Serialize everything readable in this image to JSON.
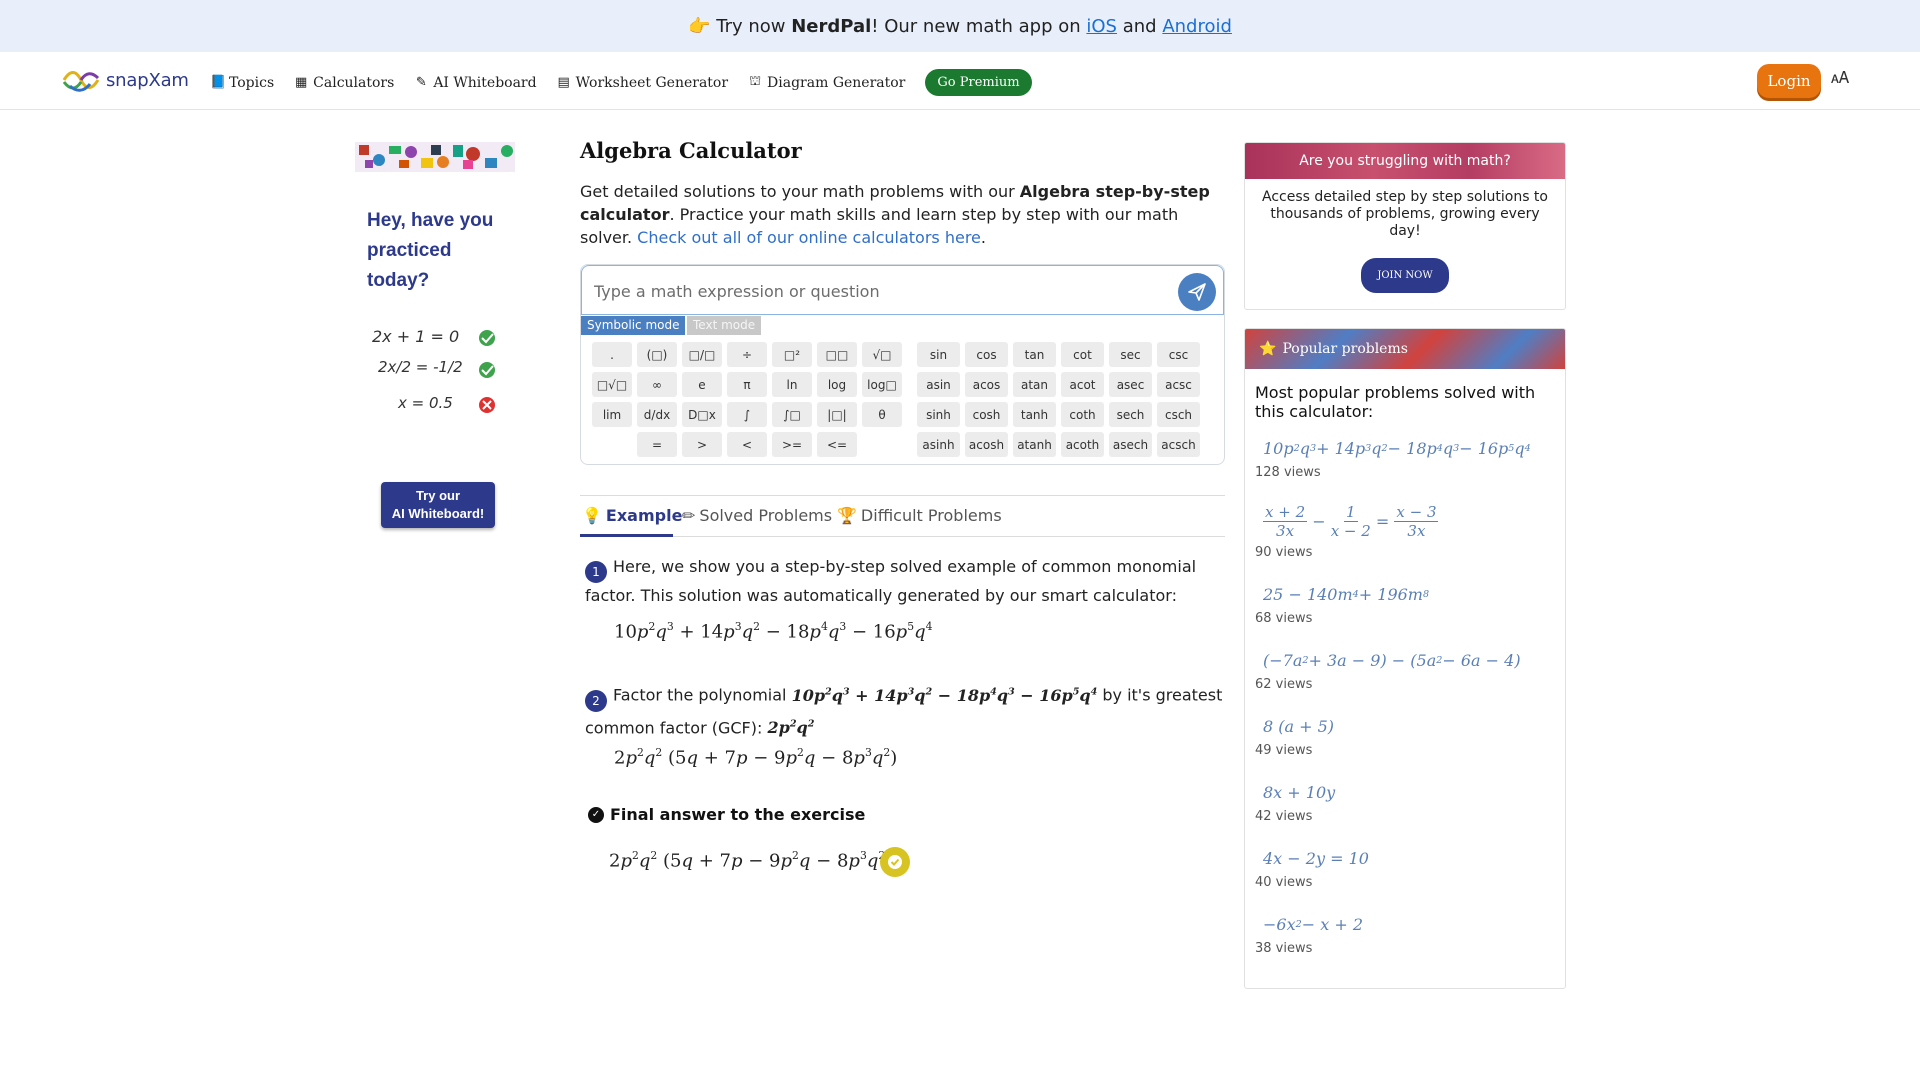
{
  "promo": {
    "emoji": "👉",
    "prefix": "Try now",
    "app_name": "NerdPal",
    "middle": "! Our new math app on",
    "ios": "iOS",
    "and": "and",
    "android": "Android"
  },
  "nav": {
    "logo": "snapXam",
    "links": [
      {
        "label": "Topics",
        "icon": "book-icon"
      },
      {
        "label": "Calculators",
        "icon": "calculator-icon"
      },
      {
        "label": "AI Whiteboard",
        "icon": "edit-icon"
      },
      {
        "label": "Worksheet Generator",
        "icon": "worksheet-icon"
      },
      {
        "label": "Diagram Generator",
        "icon": "sitemap-icon"
      }
    ],
    "premium": "Go Premium",
    "login": "Login"
  },
  "left": {
    "title": "Hey, have you practiced today?",
    "handwriting": [
      "2x + 1 = 0",
      "2x/2 = -1/2",
      "x = 0.5"
    ],
    "try_button_line1": "Try our",
    "try_button_line2": "AI Whiteboard!"
  },
  "main": {
    "title": "Algebra Calculator",
    "intro_1": "Get detailed solutions to your math problems with our ",
    "intro_bold": "Algebra step-by-step calculator",
    "intro_2": ". Practice your math skills and learn step by step with our math solver. ",
    "intro_link": "Check out all of our online calculators here",
    "intro_end": "."
  },
  "calculator": {
    "placeholder": "Type a math expression or question",
    "mode_symbolic": "Symbolic mode",
    "mode_text": "Text mode",
    "keys_left": [
      ".",
      "(□)",
      "□/□",
      "÷",
      "□²",
      "□□",
      "√□",
      "□√□",
      "∞",
      "e",
      "π",
      "ln",
      "log",
      "log□",
      "lim",
      "d/dx",
      "D□x",
      "∫",
      "∫□",
      "|□|",
      "θ",
      "",
      "=",
      ">",
      "<",
      ">=",
      "<=",
      ""
    ],
    "keys_right": [
      "sin",
      "cos",
      "tan",
      "cot",
      "sec",
      "csc",
      "asin",
      "acos",
      "atan",
      "acot",
      "asec",
      "acsc",
      "sinh",
      "cosh",
      "tanh",
      "coth",
      "sech",
      "csch",
      "asinh",
      "acosh",
      "atanh",
      "acoth",
      "asech",
      "acsch"
    ]
  },
  "tabs": {
    "example": "Example",
    "solved": "Solved Problems",
    "difficult": "Difficult Problems"
  },
  "steps": {
    "step1_num": "1",
    "step1_text": "Here, we show you a step-by-step solved example of common monomial factor. This solution was automatically generated by our smart calculator:",
    "step2_num": "2",
    "step2_text_1": "Factor the polynomial",
    "step2_text_2": "by it's greatest common factor (GCF):",
    "final_title": "Final answer to the exercise"
  },
  "promo_card": {
    "header": "Are you struggling with math?",
    "body": "Access detailed step by step solutions to thousands of problems, growing every day!",
    "button": "JOIN NOW"
  },
  "popular": {
    "header": "Popular problems",
    "subtitle": "Most popular problems solved with this calculator:",
    "items": [
      {
        "views": "128 views"
      },
      {
        "views": "90 views"
      },
      {
        "views": "68 views"
      },
      {
        "views": "62 views"
      },
      {
        "views": "49 views"
      },
      {
        "views": "42 views"
      },
      {
        "views": "40 views"
      },
      {
        "views": "38 views"
      }
    ]
  }
}
